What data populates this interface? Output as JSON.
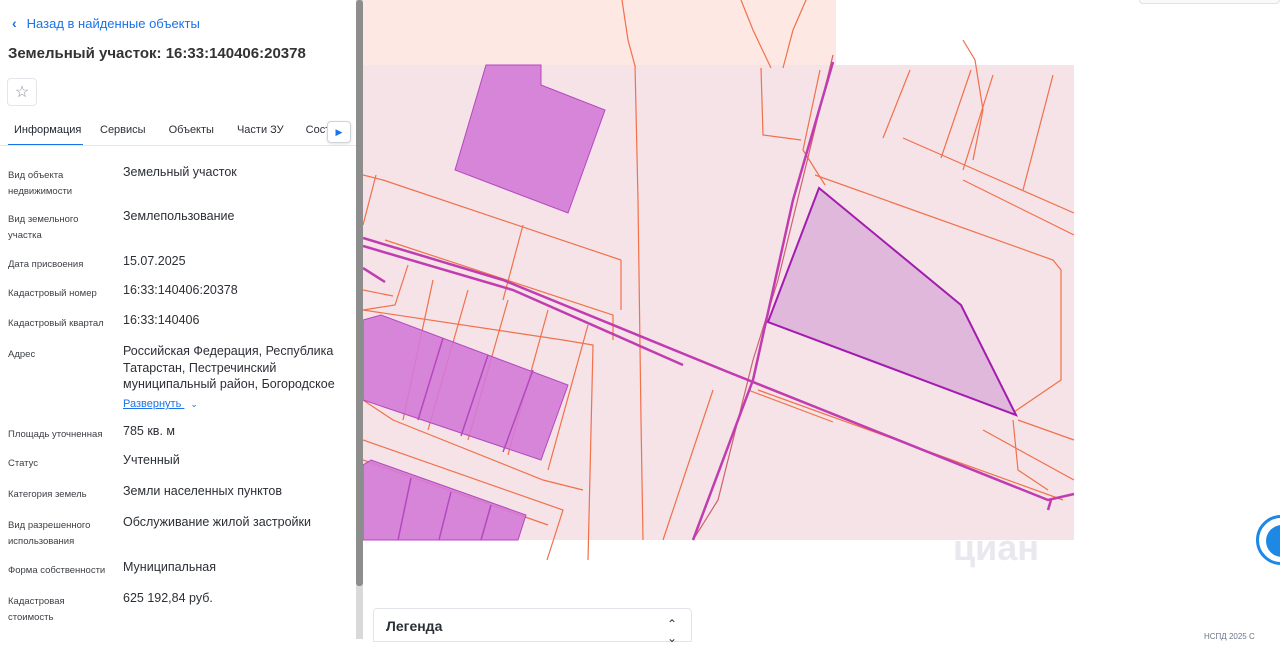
{
  "header": {
    "back_label": "Назад в найденные объекты",
    "title": "Земельный участок: 16:33:140406:20378",
    "favorite_icon": "star-icon"
  },
  "tabs": [
    {
      "label": "Информация",
      "active": true
    },
    {
      "label": "Сервисы",
      "active": false
    },
    {
      "label": "Объекты",
      "active": false
    },
    {
      "label": "Части ЗУ",
      "active": false
    },
    {
      "label": "Соста",
      "active": false
    }
  ],
  "info": {
    "object_type": {
      "label": "Вид объекта недвижимости",
      "value": "Земельный участок"
    },
    "land_type": {
      "label": "Вид земельного участка",
      "value": "Землепользование"
    },
    "assign_date": {
      "label": "Дата присвоения",
      "value": "15.07.2025"
    },
    "cadastral_number": {
      "label": "Кадастровый номер",
      "value": "16:33:140406:20378"
    },
    "cadastral_block": {
      "label": "Кадастровый квартал",
      "value": "16:33:140406"
    },
    "address": {
      "label": "Адрес",
      "value": "Российская Федерация, Республика Татарстан, Пестречинский муниципальный район, Богородское",
      "expand_label": "Развернуть"
    },
    "area": {
      "label": "Площадь уточненная",
      "value": "785 кв. м"
    },
    "status": {
      "label": "Статус",
      "value": "Учтенный"
    },
    "land_category": {
      "label": "Категория земель",
      "value": "Земли населенных пунктов"
    },
    "permitted_use": {
      "label": "Вид разрешенного использования",
      "value": "Обслуживание жилой застройки"
    },
    "ownership": {
      "label": "Форма собственности",
      "value": "Муниципальная"
    },
    "cadastral_value": {
      "label": "Кадастровая стоимость",
      "value": "625 192,84 руб."
    }
  },
  "legend": {
    "label": "Легенда",
    "toggle_icon": "chevron-updown-icon"
  },
  "watermark": "циан",
  "corner_text": "НСПД 2025 С",
  "colors": {
    "accent": "#1a73e8",
    "parcel_line": "#f2704a",
    "selected_parcel": "#a21caf",
    "building_fill": "#d47ad6",
    "map_bg": "#f5e3e8"
  }
}
